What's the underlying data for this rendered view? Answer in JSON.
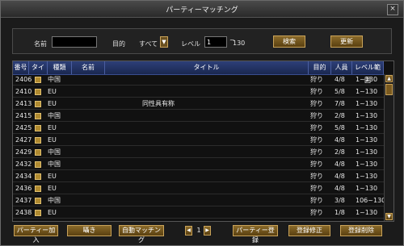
{
  "window": {
    "title": "パーティーマッチング",
    "close_glyph": "×"
  },
  "filter": {
    "name_label": "名前",
    "name_value": "",
    "purpose_label": "目的",
    "purpose_value": "すべて",
    "level_label": "レベル",
    "level_min": "1",
    "level_sep": "~",
    "level_max": "130",
    "search_label": "検索",
    "refresh_label": "更新"
  },
  "table": {
    "columns": [
      "番号",
      "タイプ",
      "種類",
      "名前",
      "タイトル",
      "目的",
      "人員",
      "レベル範囲"
    ],
    "rows": [
      {
        "no": "2406",
        "kind": "中国",
        "name": "",
        "title": "",
        "purpose": "狩り",
        "members": "4/8",
        "level": "1~130"
      },
      {
        "no": "2410",
        "kind": "EU",
        "name": "",
        "title": "",
        "purpose": "狩り",
        "members": "5/8",
        "level": "1~130"
      },
      {
        "no": "2413",
        "kind": "EU",
        "name": "",
        "title": "同性具有称",
        "purpose": "狩り",
        "members": "7/8",
        "level": "1~130"
      },
      {
        "no": "2415",
        "kind": "中国",
        "name": "",
        "title": "",
        "purpose": "狩り",
        "members": "2/8",
        "level": "1~130"
      },
      {
        "no": "2425",
        "kind": "EU",
        "name": "",
        "title": "",
        "purpose": "狩り",
        "members": "5/8",
        "level": "1~130"
      },
      {
        "no": "2427",
        "kind": "EU",
        "name": "",
        "title": "",
        "purpose": "狩り",
        "members": "4/8",
        "level": "1~130"
      },
      {
        "no": "2429",
        "kind": "中国",
        "name": "",
        "title": "",
        "purpose": "狩り",
        "members": "2/8",
        "level": "1~130"
      },
      {
        "no": "2432",
        "kind": "中国",
        "name": "",
        "title": "",
        "purpose": "狩り",
        "members": "4/8",
        "level": "1~130"
      },
      {
        "no": "2434",
        "kind": "EU",
        "name": "",
        "title": "",
        "purpose": "狩り",
        "members": "4/8",
        "level": "1~130"
      },
      {
        "no": "2436",
        "kind": "EU",
        "name": "",
        "title": "",
        "purpose": "狩り",
        "members": "4/8",
        "level": "1~130"
      },
      {
        "no": "2437",
        "kind": "中国",
        "name": "",
        "title": "",
        "purpose": "狩り",
        "members": "3/8",
        "level": "106~130"
      },
      {
        "no": "2438",
        "kind": "EU",
        "name": "",
        "title": "",
        "purpose": "狩り",
        "members": "1/8",
        "level": "1~130"
      }
    ]
  },
  "footer": {
    "join_label": "パーティー加入",
    "whisper_label": "囁き",
    "auto_label": "自動マッチング",
    "page_value": "1",
    "register_label": "パーティー登録",
    "edit_label": "登録修正",
    "delete_label": "登録削除"
  },
  "colors": {
    "accent_gold": "#c9a35a",
    "header_blue": "#2d3f78"
  }
}
